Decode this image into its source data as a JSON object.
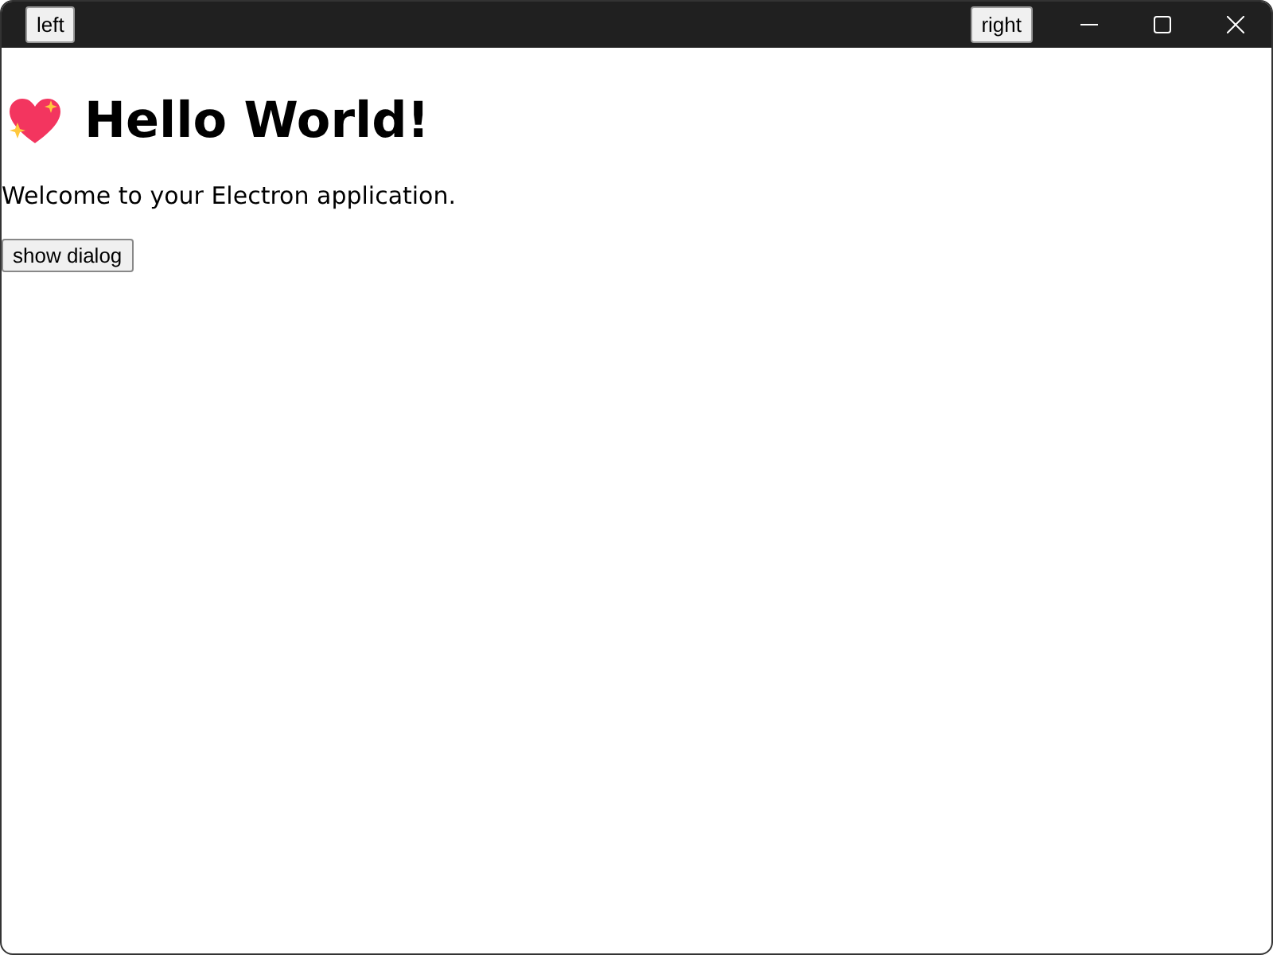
{
  "titlebar": {
    "left_button": "left",
    "right_button": "right"
  },
  "heading": "Hello World!",
  "message": "Welcome to your Electron application.",
  "button": "show dialog"
}
